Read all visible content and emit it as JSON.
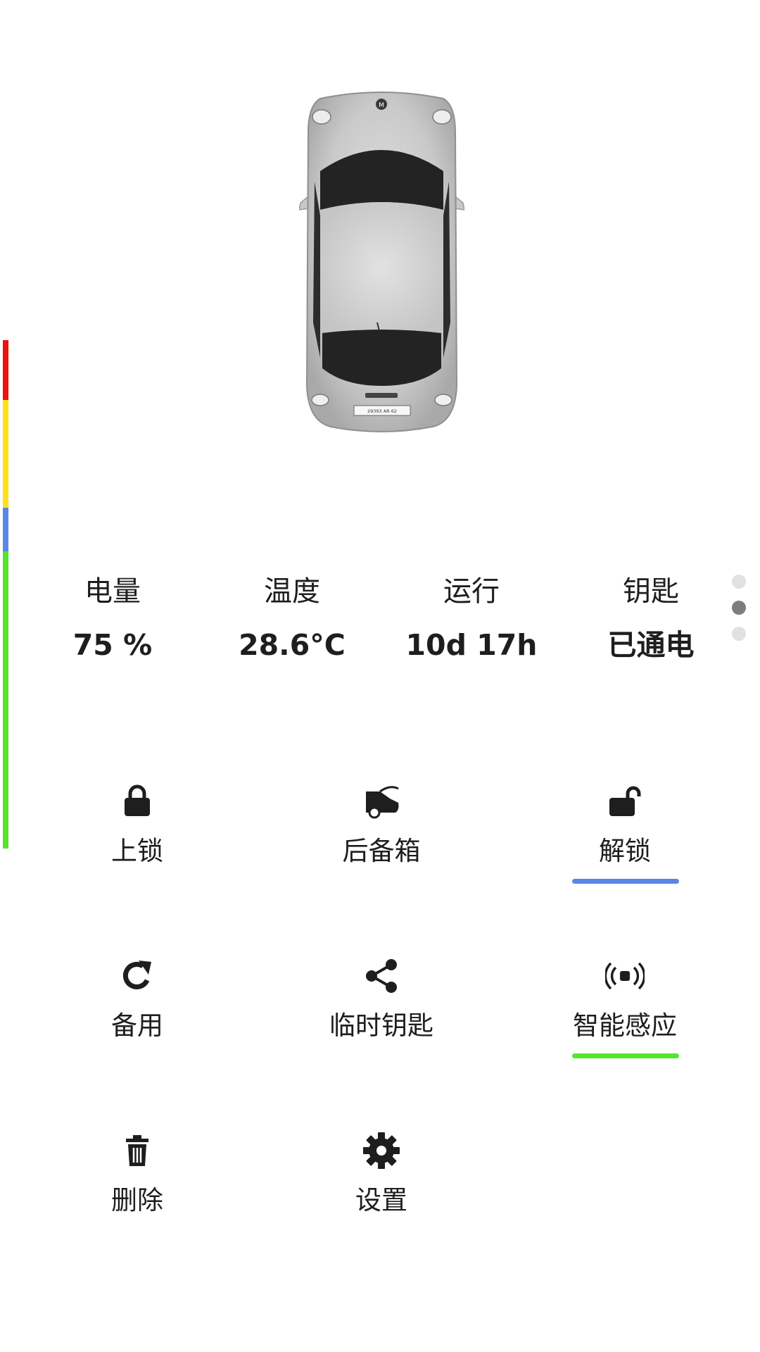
{
  "colors": {
    "strip_red": "#ee1111",
    "strip_yellow": "#ffe11a",
    "strip_blue": "#5b86e5",
    "strip_green": "#55e52a",
    "underline_blue": "#5b86e5",
    "underline_green": "#55e52a"
  },
  "car": {
    "badge": "M",
    "plate": "29393 AR 62"
  },
  "stats": [
    {
      "label": "电量",
      "value": "75 %"
    },
    {
      "label": "温度",
      "value": "28.6°C"
    },
    {
      "label": "运行",
      "value": "10d 17h"
    },
    {
      "label": "钥匙",
      "value": "已通电"
    }
  ],
  "pager": {
    "count": 3,
    "active_index": 1
  },
  "actions": [
    {
      "label": "上锁",
      "icon": "lock-icon"
    },
    {
      "label": "后备箱",
      "icon": "trunk-icon"
    },
    {
      "label": "解锁",
      "icon": "unlock-icon",
      "indicator": "blue"
    },
    {
      "label": "备用",
      "icon": "refresh-icon"
    },
    {
      "label": "临时钥匙",
      "icon": "share-icon"
    },
    {
      "label": "智能感应",
      "icon": "proximity-icon",
      "indicator": "green"
    },
    {
      "label": "删除",
      "icon": "trash-icon"
    },
    {
      "label": "设置",
      "icon": "gear-icon"
    }
  ]
}
